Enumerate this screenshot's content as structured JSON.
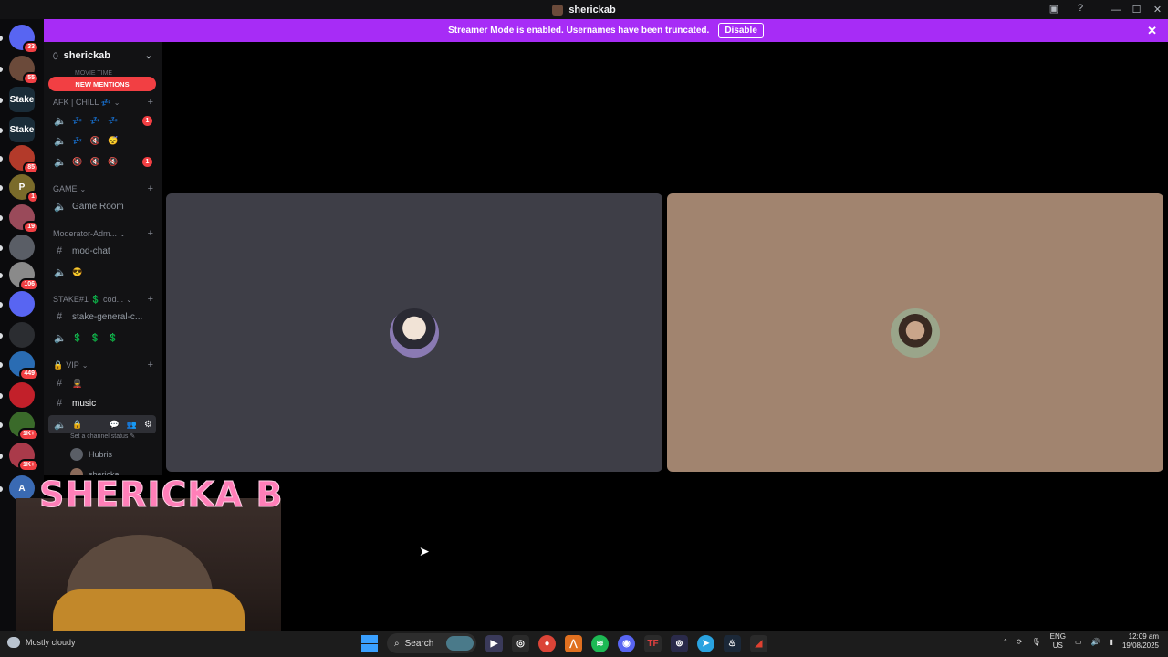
{
  "window": {
    "title": "sherickab"
  },
  "banner": {
    "message": "Streamer Mode is enabled. Usernames have been truncated.",
    "button": "Disable"
  },
  "guilds": [
    {
      "label": "",
      "badge": "33",
      "color": "#5865f2"
    },
    {
      "label": "",
      "badge": "55",
      "color": "#6b4a3a"
    },
    {
      "label": "Stake",
      "badge": "",
      "color": "#1a2c38"
    },
    {
      "label": "Stake",
      "badge": "",
      "color": "#1a2c38"
    },
    {
      "label": "",
      "badge": "85",
      "color": "#b33a2a"
    },
    {
      "label": "P",
      "badge": "1",
      "color": "#7a6b2a"
    },
    {
      "label": "",
      "badge": "19",
      "color": "#9a4a5a"
    },
    {
      "label": "",
      "badge": "",
      "color": "#5a5e66"
    },
    {
      "label": "",
      "badge": "106",
      "color": "#8a8a8a"
    },
    {
      "label": "",
      "badge": "",
      "color": "#5865f2"
    },
    {
      "label": "",
      "badge": "",
      "color": "#2b2d31"
    },
    {
      "label": "",
      "badge": "449",
      "color": "#2a6cb3"
    },
    {
      "label": "",
      "badge": "",
      "color": "#c2202a"
    },
    {
      "label": "",
      "badge": "1K+",
      "color": "#3a6a2a"
    },
    {
      "label": "",
      "badge": "1K+",
      "color": "#aa3a4a"
    },
    {
      "label": "A",
      "badge": "",
      "color": "#3a6ab3"
    }
  ],
  "sidebar": {
    "server_name": "sherickab",
    "new_mentions": "NEW MENTIONS",
    "movie_time": "MOVIE TIME",
    "categories": {
      "afk": "AFK | CHILL 💤",
      "game": "GAME",
      "moderator": "Moderator-Adm...",
      "stake": "STAKE#1 💲 cod...",
      "vip": "VIP"
    },
    "channels": {
      "afk1": "💤 💤 💤",
      "afk1_count": "1",
      "afk2": "💤 🔇 😴",
      "afk3": "🔇 🔇 🔇",
      "afk3_count": "1",
      "game_room": "Game Room",
      "mod_chat": "mod-chat",
      "mod_voice": "😎",
      "stake_general": "stake-general-c...",
      "stake_voice": "💲 💲 💲",
      "vip_text": "💂",
      "music": "music",
      "active_voice": "🔒"
    },
    "channel_status": "Set a channel status",
    "members": [
      "Hubris",
      "shericka"
    ]
  },
  "video": {
    "left_bg": "#3e3e47",
    "right_bg": "#a1846f"
  },
  "overlay": {
    "name": "SHERICKA B"
  },
  "taskbar": {
    "weather": "Mostly cloudy",
    "search": "Search",
    "lang_1": "ENG",
    "lang_2": "US",
    "time": "12:09 am",
    "date": "19/08/2025"
  }
}
